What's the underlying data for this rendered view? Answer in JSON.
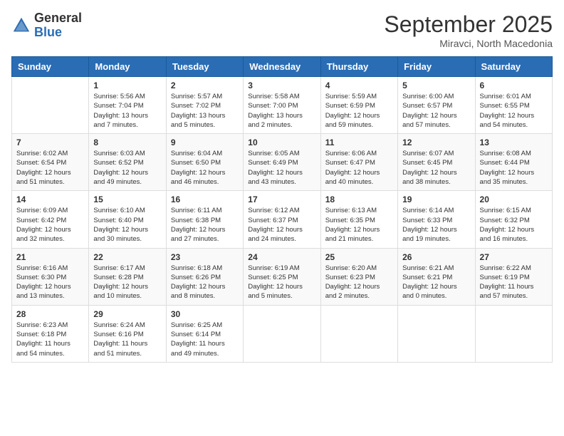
{
  "logo": {
    "general": "General",
    "blue": "Blue"
  },
  "title": "September 2025",
  "location": "Miravci, North Macedonia",
  "days_of_week": [
    "Sunday",
    "Monday",
    "Tuesday",
    "Wednesday",
    "Thursday",
    "Friday",
    "Saturday"
  ],
  "weeks": [
    [
      {
        "day": "",
        "info": ""
      },
      {
        "day": "1",
        "info": "Sunrise: 5:56 AM\nSunset: 7:04 PM\nDaylight: 13 hours\nand 7 minutes."
      },
      {
        "day": "2",
        "info": "Sunrise: 5:57 AM\nSunset: 7:02 PM\nDaylight: 13 hours\nand 5 minutes."
      },
      {
        "day": "3",
        "info": "Sunrise: 5:58 AM\nSunset: 7:00 PM\nDaylight: 13 hours\nand 2 minutes."
      },
      {
        "day": "4",
        "info": "Sunrise: 5:59 AM\nSunset: 6:59 PM\nDaylight: 12 hours\nand 59 minutes."
      },
      {
        "day": "5",
        "info": "Sunrise: 6:00 AM\nSunset: 6:57 PM\nDaylight: 12 hours\nand 57 minutes."
      },
      {
        "day": "6",
        "info": "Sunrise: 6:01 AM\nSunset: 6:55 PM\nDaylight: 12 hours\nand 54 minutes."
      }
    ],
    [
      {
        "day": "7",
        "info": "Sunrise: 6:02 AM\nSunset: 6:54 PM\nDaylight: 12 hours\nand 51 minutes."
      },
      {
        "day": "8",
        "info": "Sunrise: 6:03 AM\nSunset: 6:52 PM\nDaylight: 12 hours\nand 49 minutes."
      },
      {
        "day": "9",
        "info": "Sunrise: 6:04 AM\nSunset: 6:50 PM\nDaylight: 12 hours\nand 46 minutes."
      },
      {
        "day": "10",
        "info": "Sunrise: 6:05 AM\nSunset: 6:49 PM\nDaylight: 12 hours\nand 43 minutes."
      },
      {
        "day": "11",
        "info": "Sunrise: 6:06 AM\nSunset: 6:47 PM\nDaylight: 12 hours\nand 40 minutes."
      },
      {
        "day": "12",
        "info": "Sunrise: 6:07 AM\nSunset: 6:45 PM\nDaylight: 12 hours\nand 38 minutes."
      },
      {
        "day": "13",
        "info": "Sunrise: 6:08 AM\nSunset: 6:44 PM\nDaylight: 12 hours\nand 35 minutes."
      }
    ],
    [
      {
        "day": "14",
        "info": "Sunrise: 6:09 AM\nSunset: 6:42 PM\nDaylight: 12 hours\nand 32 minutes."
      },
      {
        "day": "15",
        "info": "Sunrise: 6:10 AM\nSunset: 6:40 PM\nDaylight: 12 hours\nand 30 minutes."
      },
      {
        "day": "16",
        "info": "Sunrise: 6:11 AM\nSunset: 6:38 PM\nDaylight: 12 hours\nand 27 minutes."
      },
      {
        "day": "17",
        "info": "Sunrise: 6:12 AM\nSunset: 6:37 PM\nDaylight: 12 hours\nand 24 minutes."
      },
      {
        "day": "18",
        "info": "Sunrise: 6:13 AM\nSunset: 6:35 PM\nDaylight: 12 hours\nand 21 minutes."
      },
      {
        "day": "19",
        "info": "Sunrise: 6:14 AM\nSunset: 6:33 PM\nDaylight: 12 hours\nand 19 minutes."
      },
      {
        "day": "20",
        "info": "Sunrise: 6:15 AM\nSunset: 6:32 PM\nDaylight: 12 hours\nand 16 minutes."
      }
    ],
    [
      {
        "day": "21",
        "info": "Sunrise: 6:16 AM\nSunset: 6:30 PM\nDaylight: 12 hours\nand 13 minutes."
      },
      {
        "day": "22",
        "info": "Sunrise: 6:17 AM\nSunset: 6:28 PM\nDaylight: 12 hours\nand 10 minutes."
      },
      {
        "day": "23",
        "info": "Sunrise: 6:18 AM\nSunset: 6:26 PM\nDaylight: 12 hours\nand 8 minutes."
      },
      {
        "day": "24",
        "info": "Sunrise: 6:19 AM\nSunset: 6:25 PM\nDaylight: 12 hours\nand 5 minutes."
      },
      {
        "day": "25",
        "info": "Sunrise: 6:20 AM\nSunset: 6:23 PM\nDaylight: 12 hours\nand 2 minutes."
      },
      {
        "day": "26",
        "info": "Sunrise: 6:21 AM\nSunset: 6:21 PM\nDaylight: 12 hours\nand 0 minutes."
      },
      {
        "day": "27",
        "info": "Sunrise: 6:22 AM\nSunset: 6:19 PM\nDaylight: 11 hours\nand 57 minutes."
      }
    ],
    [
      {
        "day": "28",
        "info": "Sunrise: 6:23 AM\nSunset: 6:18 PM\nDaylight: 11 hours\nand 54 minutes."
      },
      {
        "day": "29",
        "info": "Sunrise: 6:24 AM\nSunset: 6:16 PM\nDaylight: 11 hours\nand 51 minutes."
      },
      {
        "day": "30",
        "info": "Sunrise: 6:25 AM\nSunset: 6:14 PM\nDaylight: 11 hours\nand 49 minutes."
      },
      {
        "day": "",
        "info": ""
      },
      {
        "day": "",
        "info": ""
      },
      {
        "day": "",
        "info": ""
      },
      {
        "day": "",
        "info": ""
      }
    ]
  ]
}
